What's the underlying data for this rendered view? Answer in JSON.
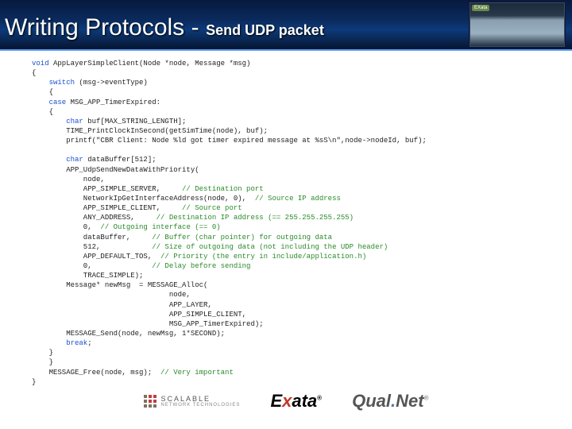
{
  "header": {
    "title_main": "Writing Protocols",
    "title_dash": "-",
    "title_sub": "Send UDP packet",
    "thumb_tag": "EXata"
  },
  "code": {
    "l01a": "void",
    "l01b": " AppLayerSimpleClient(Node *node, Message *msg)",
    "l02": "{",
    "l03a": "    switch",
    "l03b": " (msg->eventType)",
    "l04": "    {",
    "l05a": "    case",
    "l05b": " MSG_APP_TimerExpired:",
    "l06": "    {",
    "l07a": "        char",
    "l07b": " buf[MAX_STRING_LENGTH];",
    "l08": "        TIME_PrintClockInSecond(getSimTime(node), buf);",
    "l09": "        printf(\"CBR Client: Node %ld got timer expired message at %sS\\n\",node->nodeId, buf);",
    "l10": "",
    "l11a": "        char",
    "l11b": " dataBuffer[512];",
    "l12": "        APP_UdpSendNewDataWithPriority(",
    "l13": "            node,",
    "l14a": "            APP_SIMPLE_SERVER,     ",
    "l14b": "// Destination port",
    "l15a": "            NetworkIpGetInterfaceAddress(node, 0),  ",
    "l15b": "// Source IP address",
    "l16a": "            APP_SIMPLE_CLIENT,     ",
    "l16b": "// Source port",
    "l17a": "            ANY_ADDRESS,     ",
    "l17b": "// Destination IP address (== 255.255.255.255)",
    "l18a": "            0,  ",
    "l18b": "// Outgoing interface (== 0)",
    "l19a": "            dataBuffer,     ",
    "l19b": "// Buffer (char pointer) for outgoing data",
    "l20a": "            512,            ",
    "l20b": "// Size of outgoing data (not including the UDP header)",
    "l21a": "            APP_DEFAULT_TOS,  ",
    "l21b": "// Priority (the entry in include/application.h)",
    "l22a": "            0,              ",
    "l22b": "// Delay before sending",
    "l23": "            TRACE_SIMPLE);",
    "l24": "        Message* newMsg  = MESSAGE_Alloc(",
    "l25": "                                node,",
    "l26": "                                APP_LAYER,",
    "l27": "                                APP_SIMPLE_CLIENT,",
    "l28": "                                MSG_APP_TimerExpired);",
    "l29": "        MESSAGE_Send(node, newMsg, 1*SECOND);",
    "l30a": "        break",
    "l30b": ";",
    "l31": "    }",
    "l32": "    }",
    "l33a": "    MESSAGE_Free(node, msg);  ",
    "l33b": "// Very important",
    "l34": "}"
  },
  "footer": {
    "snt_top": "SCALABLE",
    "snt_bottom": "NETWORK TECHNOLOGIES",
    "exata_pre": "E",
    "exata_x": "x",
    "exata_post": "ata",
    "exata_reg": "®",
    "qualnet_pre": "Qual",
    "qualnet_dot": ".",
    "qualnet_post": "Net",
    "qualnet_reg": "®"
  }
}
